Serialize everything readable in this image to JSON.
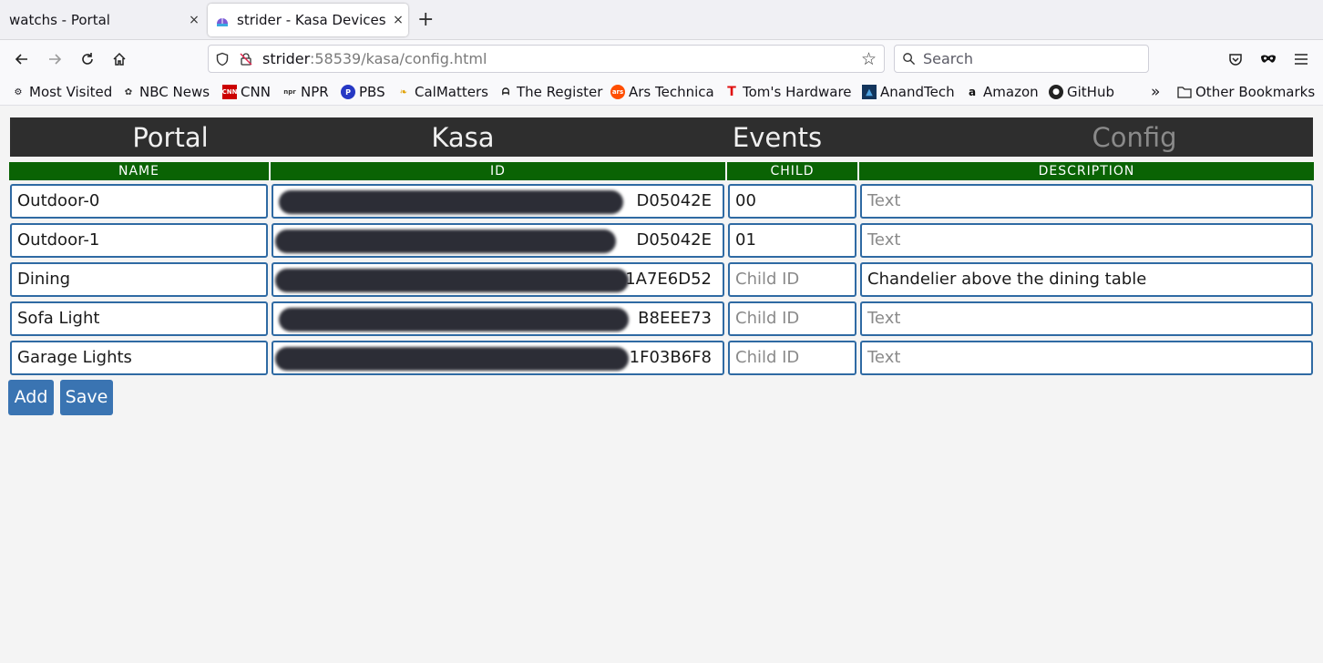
{
  "browser": {
    "tabs": [
      {
        "title": "watchs - Portal",
        "close": "×"
      },
      {
        "title": "strider - Kasa Devices",
        "close": "×"
      }
    ],
    "new_tab": "+",
    "url_host": "strider",
    "url_rest": ":58539/kasa/config.html",
    "search_placeholder": "Search",
    "bookmarks": [
      {
        "label": "Most Visited",
        "icon": "gear-icon"
      },
      {
        "label": "NBC News",
        "icon": "nbc-icon"
      },
      {
        "label": "CNN",
        "icon": "cnn-icon"
      },
      {
        "label": "NPR",
        "icon": "npr-icon"
      },
      {
        "label": "PBS",
        "icon": "pbs-icon"
      },
      {
        "label": "CalMatters",
        "icon": "calmatters-icon"
      },
      {
        "label": "The Register",
        "icon": "register-icon"
      },
      {
        "label": "Ars Technica",
        "icon": "ars-icon"
      },
      {
        "label": "Tom's Hardware",
        "icon": "toms-icon"
      },
      {
        "label": "AnandTech",
        "icon": "anandtech-icon"
      },
      {
        "label": "Amazon",
        "icon": "amazon-icon"
      },
      {
        "label": "GitHub",
        "icon": "github-icon"
      }
    ],
    "overflow": "»",
    "other_bookmarks": "Other Bookmarks"
  },
  "app": {
    "nav": [
      "Portal",
      "Kasa",
      "Events",
      "Config"
    ],
    "active_nav": "Config",
    "columns": [
      "NAME",
      "ID",
      "CHILD",
      "DESCRIPTION"
    ],
    "placeholders": {
      "child": "Child ID",
      "description": "Text"
    },
    "rows": [
      {
        "name": "Outdoor-0",
        "id_suffix": "D05042E",
        "child": "00",
        "description": ""
      },
      {
        "name": "Outdoor-1",
        "id_suffix": "D05042E",
        "child": "01",
        "description": ""
      },
      {
        "name": "Dining",
        "id_suffix": "1A7E6D52",
        "child": "",
        "description": "Chandelier above the dining table"
      },
      {
        "name": "Sofa Light",
        "id_suffix": "B8EEE73",
        "child": "",
        "description": ""
      },
      {
        "name": "Garage Lights",
        "id_suffix": "1F03B6F8",
        "child": "",
        "description": ""
      }
    ],
    "buttons": {
      "add": "Add",
      "save": "Save"
    }
  },
  "colors": {
    "header_green": "#0a6304",
    "nav_bg": "#2e2e2e",
    "field_border": "#2f6aa3",
    "button_blue": "#3a74b2"
  }
}
